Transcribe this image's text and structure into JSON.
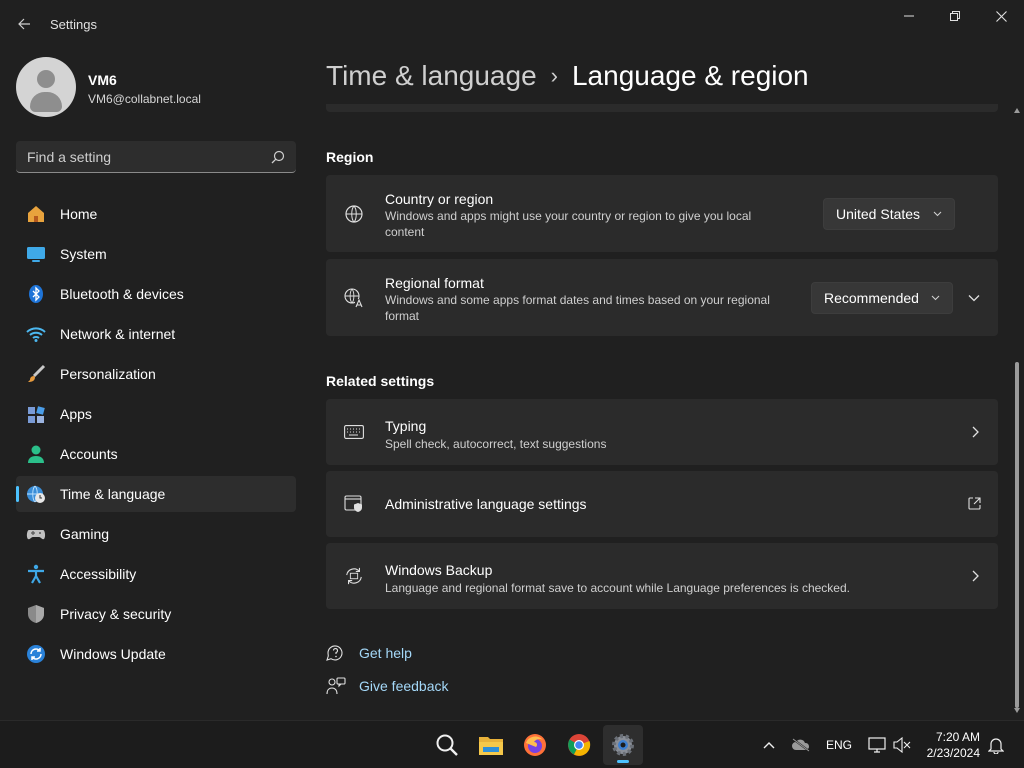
{
  "window": {
    "title": "Settings"
  },
  "profile": {
    "name": "VM6",
    "email": "VM6@collabnet.local"
  },
  "search": {
    "placeholder": "Find a setting"
  },
  "nav": {
    "items": [
      {
        "label": "Home",
        "icon": "home-icon"
      },
      {
        "label": "System",
        "icon": "system-icon"
      },
      {
        "label": "Bluetooth & devices",
        "icon": "bluetooth-icon"
      },
      {
        "label": "Network & internet",
        "icon": "wifi-icon"
      },
      {
        "label": "Personalization",
        "icon": "brush-icon"
      },
      {
        "label": "Apps",
        "icon": "apps-icon"
      },
      {
        "label": "Accounts",
        "icon": "accounts-icon"
      },
      {
        "label": "Time & language",
        "icon": "globe-clock-icon",
        "selected": true
      },
      {
        "label": "Gaming",
        "icon": "gamepad-icon"
      },
      {
        "label": "Accessibility",
        "icon": "accessibility-icon"
      },
      {
        "label": "Privacy & security",
        "icon": "shield-icon"
      },
      {
        "label": "Windows Update",
        "icon": "update-icon"
      }
    ]
  },
  "header": {
    "parent": "Time & language",
    "separator": "›",
    "current": "Language & region"
  },
  "region": {
    "title": "Region",
    "country": {
      "title": "Country or region",
      "desc": "Windows and apps might use your country or region to give you local content",
      "value": "United States"
    },
    "format": {
      "title": "Regional format",
      "desc": "Windows and some apps format dates and times based on your regional format",
      "value": "Recommended"
    }
  },
  "related": {
    "title": "Related settings",
    "typing": {
      "title": "Typing",
      "desc": "Spell check, autocorrect, text suggestions"
    },
    "admin": {
      "title": "Administrative language settings"
    },
    "backup": {
      "title": "Windows Backup",
      "desc": "Language and regional format save to account while Language preferences is checked."
    }
  },
  "links": {
    "help": "Get help",
    "feedback": "Give feedback"
  },
  "taskbar": {
    "apps": [
      "search-icon",
      "file-explorer-icon",
      "firefox-icon",
      "chrome-icon",
      "settings-icon"
    ],
    "active_app": "settings-icon",
    "language": "ENG",
    "time": "7:20 AM",
    "date": "2/23/2024"
  },
  "colors": {
    "accent": "#4cc2ff",
    "background": "#202020",
    "card": "#2b2b2b",
    "link": "#a4d8f8"
  }
}
